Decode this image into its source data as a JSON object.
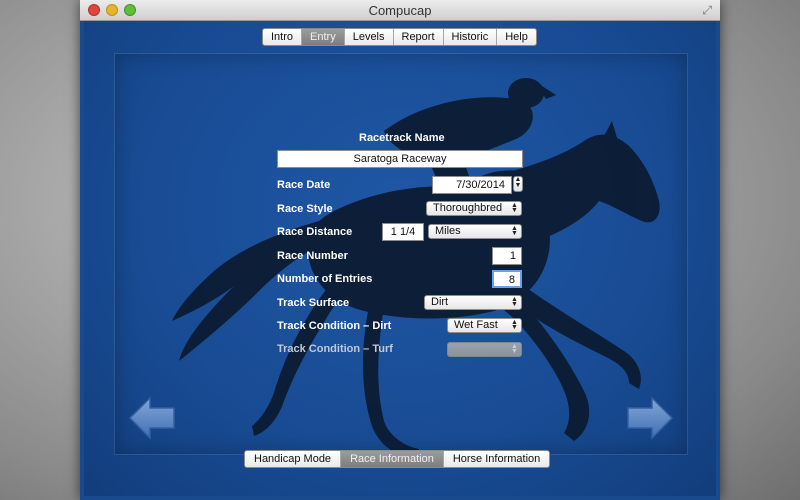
{
  "window": {
    "title": "Compucap",
    "fullscreen_icon": "expand-icon"
  },
  "top_tabs": {
    "items": [
      {
        "label": "Intro",
        "selected": false
      },
      {
        "label": "Entry",
        "selected": true
      },
      {
        "label": "Levels",
        "selected": false
      },
      {
        "label": "Report",
        "selected": false
      },
      {
        "label": "Historic",
        "selected": false
      },
      {
        "label": "Help",
        "selected": false
      }
    ]
  },
  "form": {
    "racetrack_label": "Racetrack Name",
    "racetrack_value": "Saratoga Raceway",
    "race_date_label": "Race Date",
    "race_date_value": "7/30/2014",
    "race_style_label": "Race Style",
    "race_style_value": "Thoroughbred",
    "race_distance_label": "Race Distance",
    "race_distance_value": "1 1/4",
    "race_distance_unit": "Miles",
    "race_number_label": "Race Number",
    "race_number_value": "1",
    "num_entries_label": "Number of Entries",
    "num_entries_value": "8",
    "track_surface_label": "Track Surface",
    "track_surface_value": "Dirt",
    "cond_dirt_label": "Track Condition – Dirt",
    "cond_dirt_value": "Wet Fast",
    "cond_turf_label": "Track Condition – Turf",
    "cond_turf_value": ""
  },
  "bottom_tabs": {
    "items": [
      {
        "label": "Handicap Mode",
        "selected": false
      },
      {
        "label": "Race Information",
        "selected": true
      },
      {
        "label": "Horse Information",
        "selected": false
      }
    ]
  },
  "nav": {
    "back_icon": "left-arrow-icon",
    "forward_icon": "right-arrow-icon"
  },
  "colors": {
    "background_blue": "#1a4a8e",
    "silhouette": "#0b1a30"
  }
}
